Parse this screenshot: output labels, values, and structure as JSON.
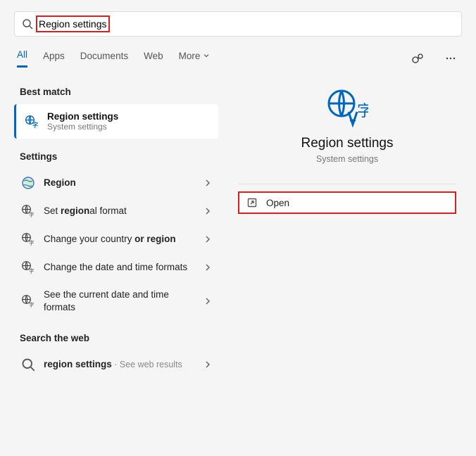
{
  "search": {
    "text": "Region settings"
  },
  "tabs": {
    "all": "All",
    "apps": "Apps",
    "documents": "Documents",
    "web": "Web",
    "more": "More"
  },
  "sections": {
    "best_match": "Best match",
    "settings": "Settings",
    "search_web": "Search the web"
  },
  "best_match": {
    "title": "Region settings",
    "sub": "System settings"
  },
  "settings_items": {
    "region": "Region",
    "regional_format_pre": "Set ",
    "regional_format_b": "region",
    "regional_format_post": "al format",
    "country_pre": "Change your country ",
    "country_b": "or ",
    "country_b2": "region",
    "datetime": "Change the date and time formats",
    "seetime": "See the current date and time formats"
  },
  "web": {
    "query": "region settings",
    "hint": " · See web results"
  },
  "detail": {
    "title": "Region settings",
    "sub": "System settings",
    "open": "Open"
  }
}
